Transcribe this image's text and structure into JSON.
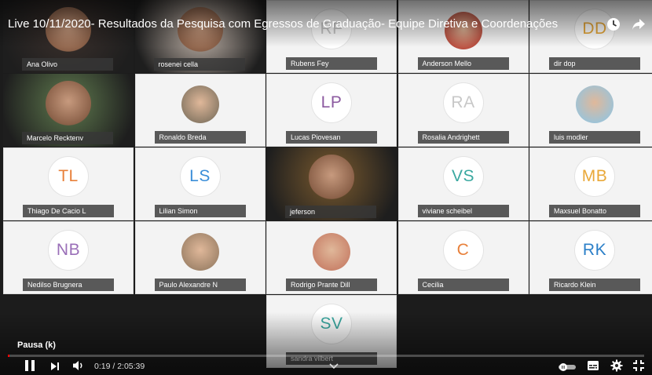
{
  "video": {
    "title": "Live 10/11/2020- Resultados da Pesquisa com Egressos de Graduação- Equipe Diretiva e Coordenações",
    "tooltip": "Pausa (k)",
    "time": "0:19 / 2:05:39",
    "progress_fraction": 0.0025
  },
  "participants": [
    {
      "name": "Ana Olivo",
      "type": "camera",
      "bg": "#3b302c"
    },
    {
      "name": "rosenei cella",
      "type": "camera",
      "bg": "#cdbfb4"
    },
    {
      "name": "Rubens Fey",
      "type": "initials",
      "initials": "RF",
      "color": "#c8c8c8"
    },
    {
      "name": "Anderson Mello",
      "type": "avatar",
      "bg": "#b84a3c"
    },
    {
      "name": "dir dop",
      "type": "initials",
      "initials": "DD",
      "color": "#e7a83a"
    },
    {
      "name": "Marcelo Recktenv",
      "type": "camera",
      "bg": "#5f7a4e"
    },
    {
      "name": "Ronaldo Breda",
      "type": "avatar",
      "bg": "#8a7a66"
    },
    {
      "name": "Lucas Piovesan",
      "type": "initials",
      "initials": "LP",
      "color": "#8c5aa0"
    },
    {
      "name": "Rosalia Andrighett",
      "type": "initials",
      "initials": "RA",
      "color": "#c8c8c8"
    },
    {
      "name": "luis modler",
      "type": "avatar",
      "bg": "#9cc3d8"
    },
    {
      "name": "Thiago De Cacio L",
      "type": "initials",
      "initials": "TL",
      "color": "#e8803a"
    },
    {
      "name": "Lilian Simon",
      "type": "initials",
      "initials": "LS",
      "color": "#3b8ed8"
    },
    {
      "name": "jeferson",
      "type": "camera",
      "bg": "#7a5a2e"
    },
    {
      "name": "viviane scheibel",
      "type": "initials",
      "initials": "VS",
      "color": "#3aa8a0"
    },
    {
      "name": "Maxsuel Bonatto",
      "type": "initials",
      "initials": "MB",
      "color": "#e9a838"
    },
    {
      "name": "Nedilso Brugnera",
      "type": "initials",
      "initials": "NB",
      "color": "#9a6fb8"
    },
    {
      "name": "Paulo Alexandre N",
      "type": "avatar",
      "bg": "#a0846a"
    },
    {
      "name": "Rodrigo Prante Dill",
      "type": "avatar",
      "bg": "#c9826a"
    },
    {
      "name": "Cecilia",
      "type": "initials",
      "initials": "C",
      "color": "#e8803a"
    },
    {
      "name": "Ricardo Klein",
      "type": "initials",
      "initials": "RK",
      "color": "#2b7fc8"
    },
    {
      "name": "sandra vilbert",
      "type": "initials",
      "initials": "SV",
      "color": "#3aa8a0"
    }
  ],
  "icons": {
    "clock": "clock-icon",
    "share": "share-icon",
    "play_pause": "pause-icon",
    "next": "next-icon",
    "volume": "volume-icon",
    "autoplay": "autoplay-toggle-icon",
    "subtitles": "subtitles-icon",
    "settings": "gear-icon",
    "fullscreen": "exit-fullscreen-icon"
  }
}
